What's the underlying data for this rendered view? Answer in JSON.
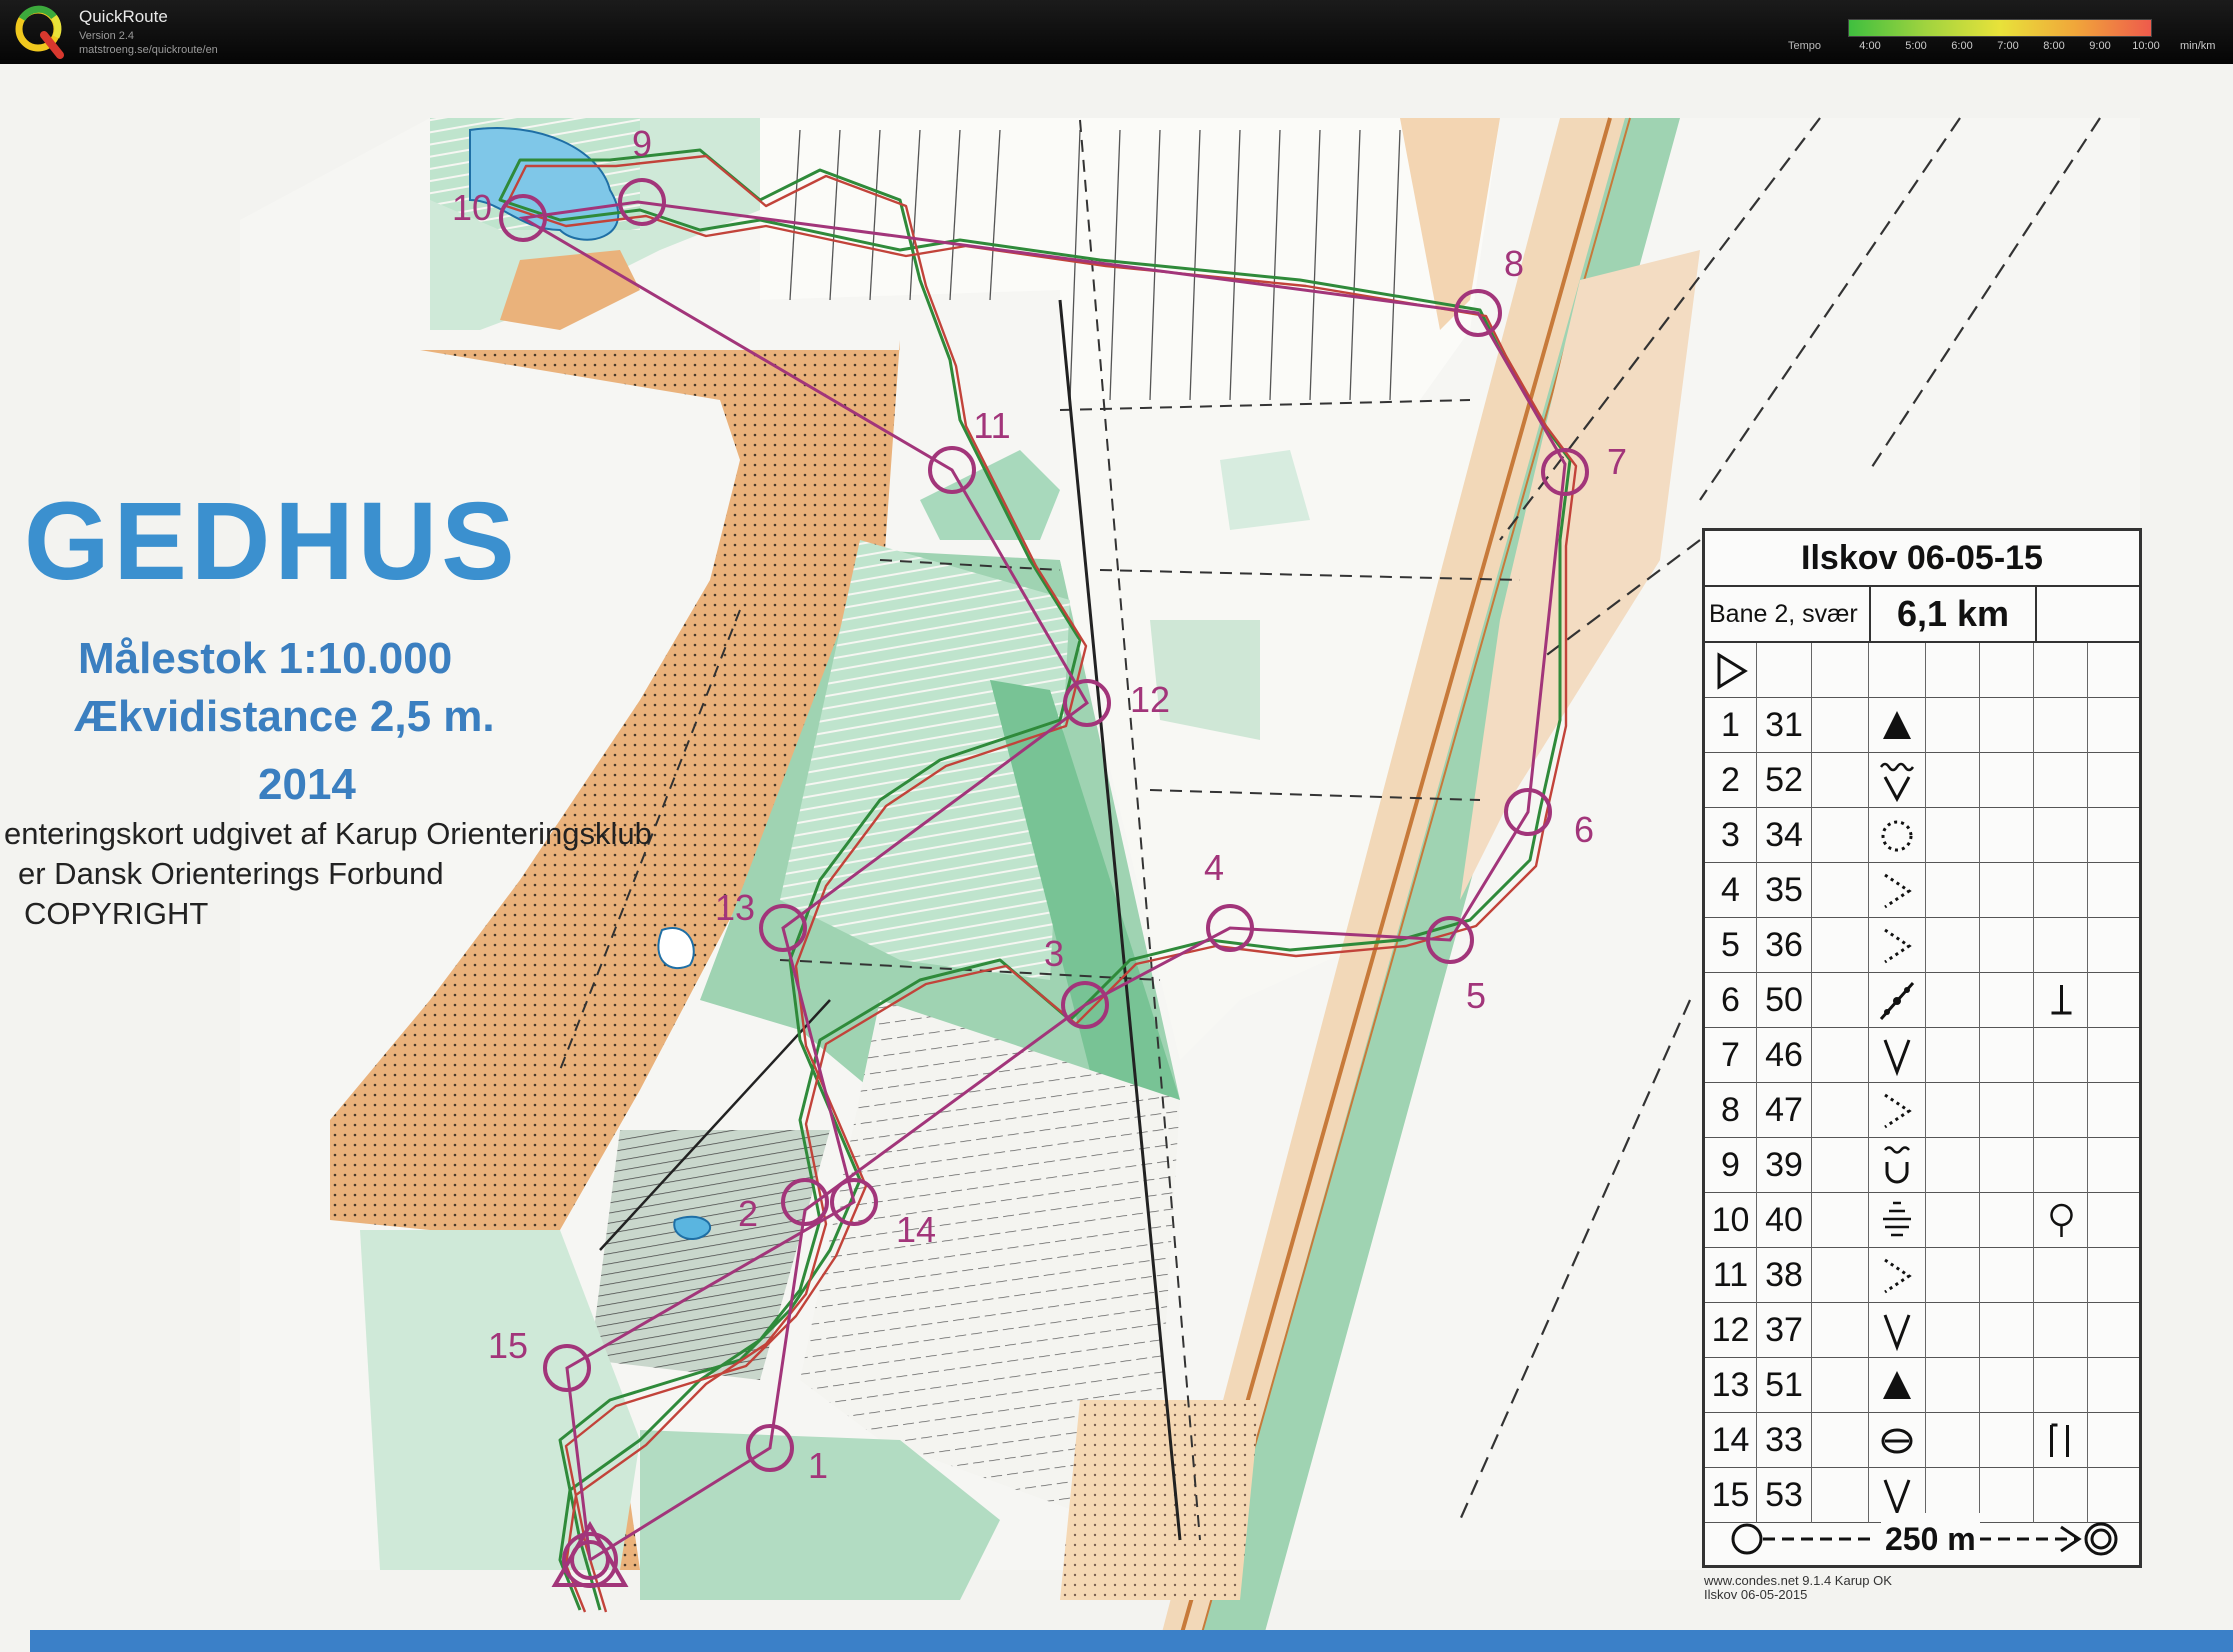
{
  "app": {
    "name": "QuickRoute",
    "version": "Version 2.4",
    "url": "matstroeng.se/quickroute/en"
  },
  "tempo_legend": {
    "label": "Tempo",
    "ticks": [
      "4:00",
      "5:00",
      "6:00",
      "7:00",
      "8:00",
      "9:00",
      "10:00"
    ],
    "unit": "min/km",
    "colors": [
      "#3fbf3f",
      "#9fd33f",
      "#e8e23a",
      "#f0a63a",
      "#ee5b4c"
    ]
  },
  "map": {
    "title": "GEDHUS",
    "scale": "Målestok 1:10.000",
    "contour": "Ækvidistance 2,5 m.",
    "year": "2014",
    "publisher": "enteringskort udgivet af Karup Orienteringsklub",
    "federation": "er Dansk Orienterings Forbund",
    "copyright": "COPYRIGHT",
    "footer_line1": "www.condes.net 9.1.4 Karup OK",
    "footer_line2": "Ilskov 06-05-2015",
    "colors": {
      "course": "#a2357a",
      "route_green": "#2f8a3a",
      "route_red": "#c2433a",
      "open_land": "#eab27b",
      "forest_green": "#9fd3b2",
      "title_blue": "#3b90cf"
    },
    "control_labels": [
      "1",
      "2",
      "3",
      "4",
      "5",
      "6",
      "7",
      "8",
      "9",
      "10",
      "11",
      "12",
      "13",
      "14",
      "15"
    ]
  },
  "card": {
    "title": "Ilskov 06-05-15",
    "course": "Bane 2, svær",
    "length": "6,1 km",
    "finish_distance": "250 m",
    "rows": [
      {
        "num": "1",
        "code": "31",
        "symbol": "hill-triangle",
        "extra": ""
      },
      {
        "num": "2",
        "code": "52",
        "symbol": "gully-marsh",
        "extra": ""
      },
      {
        "num": "3",
        "code": "34",
        "symbol": "dotted-circle",
        "extra": ""
      },
      {
        "num": "4",
        "code": "35",
        "symbol": "dotted-v",
        "extra": ""
      },
      {
        "num": "5",
        "code": "36",
        "symbol": "dotted-v",
        "extra": ""
      },
      {
        "num": "6",
        "code": "50",
        "symbol": "path-junction",
        "extra": "foot"
      },
      {
        "num": "7",
        "code": "46",
        "symbol": "v-depression",
        "extra": ""
      },
      {
        "num": "8",
        "code": "47",
        "symbol": "dotted-v",
        "extra": ""
      },
      {
        "num": "9",
        "code": "39",
        "symbol": "pit-marsh",
        "extra": ""
      },
      {
        "num": "10",
        "code": "40",
        "symbol": "marsh",
        "extra": "circle-side"
      },
      {
        "num": "11",
        "code": "38",
        "symbol": "dotted-v",
        "extra": ""
      },
      {
        "num": "12",
        "code": "37",
        "symbol": "v-depression",
        "extra": ""
      },
      {
        "num": "13",
        "code": "51",
        "symbol": "hill-triangle",
        "extra": ""
      },
      {
        "num": "14",
        "code": "33",
        "symbol": "boulder-oval",
        "extra": "double-bar"
      },
      {
        "num": "15",
        "code": "53",
        "symbol": "v-depression",
        "extra": ""
      }
    ]
  }
}
